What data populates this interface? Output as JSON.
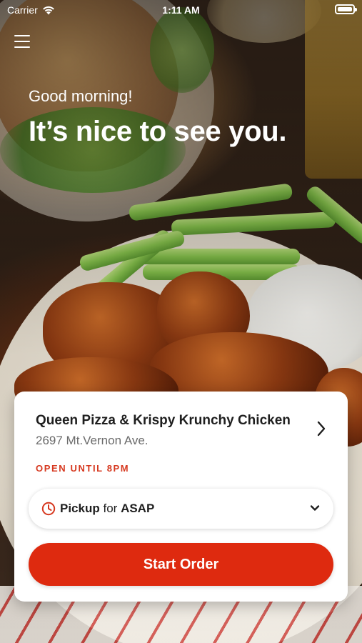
{
  "status_bar": {
    "carrier": "Carrier",
    "time": "1:11 AM",
    "battery_level": 1.0
  },
  "icons": {
    "menu": "hamburger-icon",
    "wifi": "wifi-icon",
    "battery": "battery-icon",
    "clock": "clock-icon",
    "chevron_right": "chevron-right-icon",
    "chevron_down": "chevron-down-icon"
  },
  "header": {
    "greeting": "Good morning!",
    "headline": "It’s nice to see you."
  },
  "store_card": {
    "name": "Queen Pizza & Krispy Krunchy Chicken",
    "address": "2697 Mt.Vernon Ave.",
    "hours_status": "OPEN UNTIL 8PM",
    "order_type": "Pickup",
    "for_label": "for",
    "timing": "ASAP",
    "start_button": "Start Order"
  },
  "colors": {
    "accent": "#de2a0f",
    "accent_text": "#d6381f",
    "card_bg": "#ffffff",
    "primary_text": "#1e1e1e",
    "secondary_text": "#6a6a6a"
  }
}
